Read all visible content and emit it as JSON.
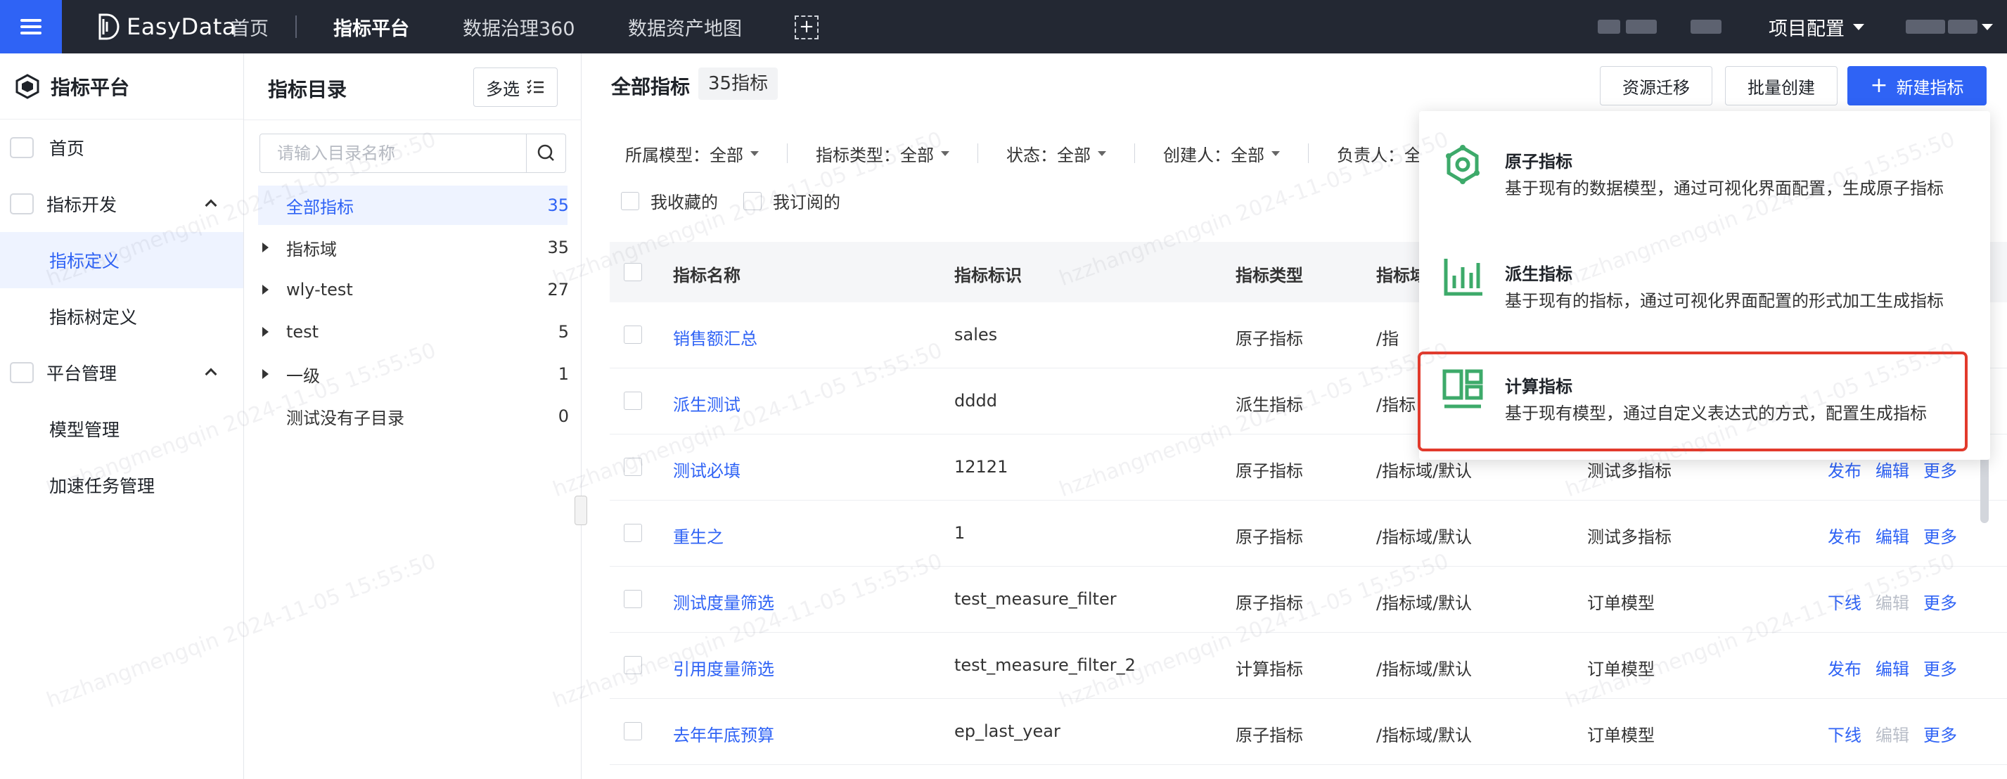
{
  "topbar": {
    "brand": "EasyData",
    "nav": [
      "首页",
      "指标平台",
      "数据治理360",
      "数据资产地图"
    ],
    "active_nav": "指标平台",
    "project": "项目配置"
  },
  "leftnav": {
    "title": "指标平台",
    "items": [
      {
        "label": "首页"
      },
      {
        "label": "指标开发"
      },
      {
        "label": "指标定义"
      },
      {
        "label": "指标树定义"
      },
      {
        "label": "平台管理"
      },
      {
        "label": "模型管理"
      },
      {
        "label": "加速任务管理"
      }
    ]
  },
  "dir": {
    "title": "指标目录",
    "multi_label": "多选",
    "search_placeholder": "请输入目录名称",
    "tree": [
      {
        "label": "全部指标",
        "count": "35"
      },
      {
        "label": "指标域",
        "count": "35"
      },
      {
        "label": "wly-test",
        "count": "27"
      },
      {
        "label": "test",
        "count": "5"
      },
      {
        "label": "一级",
        "count": "1"
      },
      {
        "label": "测试没有子目录",
        "count": "0"
      }
    ]
  },
  "main": {
    "title": "全部指标",
    "badge": "35指标",
    "buttons": {
      "migrate": "资源迁移",
      "batch": "批量创建",
      "new": "新建指标"
    },
    "filters": [
      {
        "label": "所属模型：全部"
      },
      {
        "label": "指标类型：全部"
      },
      {
        "label": "状态：全部"
      },
      {
        "label": "创建人：全部"
      },
      {
        "label": "负责人：全"
      }
    ],
    "favs": {
      "fav": "我收藏的",
      "sub": "我订阅的"
    },
    "columns": [
      "指标名称",
      "指标标识",
      "指标类型",
      "指标域"
    ],
    "rows": [
      {
        "name": "销售额汇总",
        "id": "sales",
        "type": "原子指标",
        "path": "/指",
        "model": "",
        "actions": []
      },
      {
        "name": "派生测试",
        "id": "dddd",
        "type": "派生指标",
        "path": "/指标",
        "model": "",
        "actions": []
      },
      {
        "name": "测试必填",
        "id": "12121",
        "type": "原子指标",
        "path": "/指标域/默认",
        "model": "测试多指标",
        "actions": [
          "发布",
          "编辑",
          "更多"
        ]
      },
      {
        "name": "重生之",
        "id": "1",
        "type": "原子指标",
        "path": "/指标域/默认",
        "model": "测试多指标",
        "actions": [
          "发布",
          "编辑",
          "更多"
        ]
      },
      {
        "name": "测试度量筛选",
        "id": "test_measure_filter",
        "type": "原子指标",
        "path": "/指标域/默认",
        "model": "订单模型",
        "actions": [
          "下线",
          "编辑",
          "更多"
        ]
      },
      {
        "name": "引用度量筛选",
        "id": "test_measure_filter_2",
        "type": "计算指标",
        "path": "/指标域/默认",
        "model": "订单模型",
        "actions": [
          "发布",
          "编辑",
          "更多"
        ]
      },
      {
        "name": "去年年底预算",
        "id": "ep_last_year",
        "type": "原子指标",
        "path": "/指标域/默认",
        "model": "订单模型",
        "actions": [
          "下线",
          "编辑",
          "更多"
        ]
      }
    ]
  },
  "dropdown": {
    "items": [
      {
        "title": "原子指标",
        "desc": "基于现有的数据模型，通过可视化界面配置，生成原子指标",
        "icon": "atom-gear-icon"
      },
      {
        "title": "派生指标",
        "desc": "基于现有的指标，通过可视化界面配置的形式加工生成指标",
        "icon": "bar-chart-icon"
      },
      {
        "title": "计算指标",
        "desc": "基于现有模型，通过自定义表达式的方式，配置生成指标",
        "icon": "layout-calc-icon"
      }
    ]
  },
  "watermark": "hzzhangmengqin 2024-11-05 15:55:50",
  "colors": {
    "primary": "#2f63f5",
    "topbar": "#232833",
    "icon_green": "#3daa6a",
    "highlight": "#e23a2c"
  }
}
